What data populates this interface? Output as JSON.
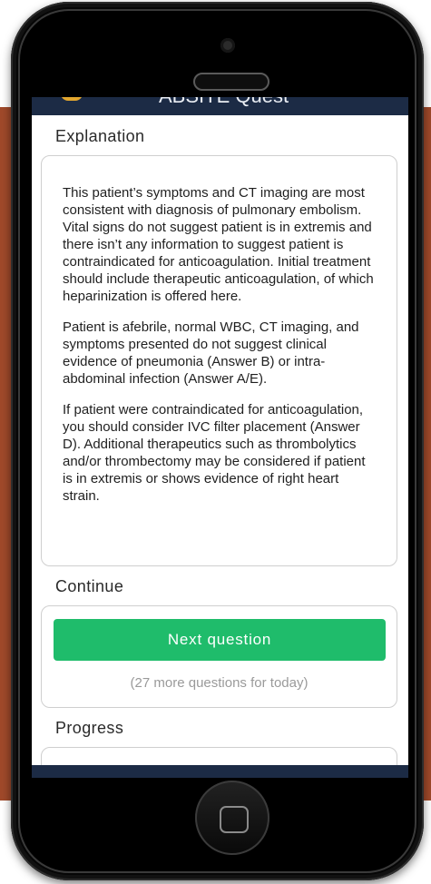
{
  "app": {
    "title": "ABSITE Quest"
  },
  "explanation": {
    "heading": "Explanation",
    "paragraphs": [
      "This patient’s symptoms and CT imaging are most consistent with diagnosis of pulmonary embolism. Vital signs do not suggest patient is in extremis and there isn’t any information to suggest patient is contraindicated for anticoagulation. Initial treatment should include therapeutic anticoagulation, of which heparinization is offered here.",
      "Patient is afebrile, normal WBC, CT imaging, and symptoms presented do not suggest clinical evidence of pneumonia (Answer B) or intra-abdominal infection (Answer A/E).",
      "If patient were contraindicated for anticoagulation, you should consider IVC filter placement (Answer D). Additional therapeutics such as thrombolytics and/or thrombectomy may be considered if patient is in extremis or shows evidence of right heart strain."
    ]
  },
  "continue": {
    "heading": "Continue",
    "button_label": "Next question",
    "remaining_note": "(27 more questions for today)"
  },
  "progress": {
    "heading": "Progress"
  },
  "colors": {
    "accent_green": "#1fbc6b",
    "header_navy": "#1c2b45",
    "background_rust": "#a0492a"
  }
}
